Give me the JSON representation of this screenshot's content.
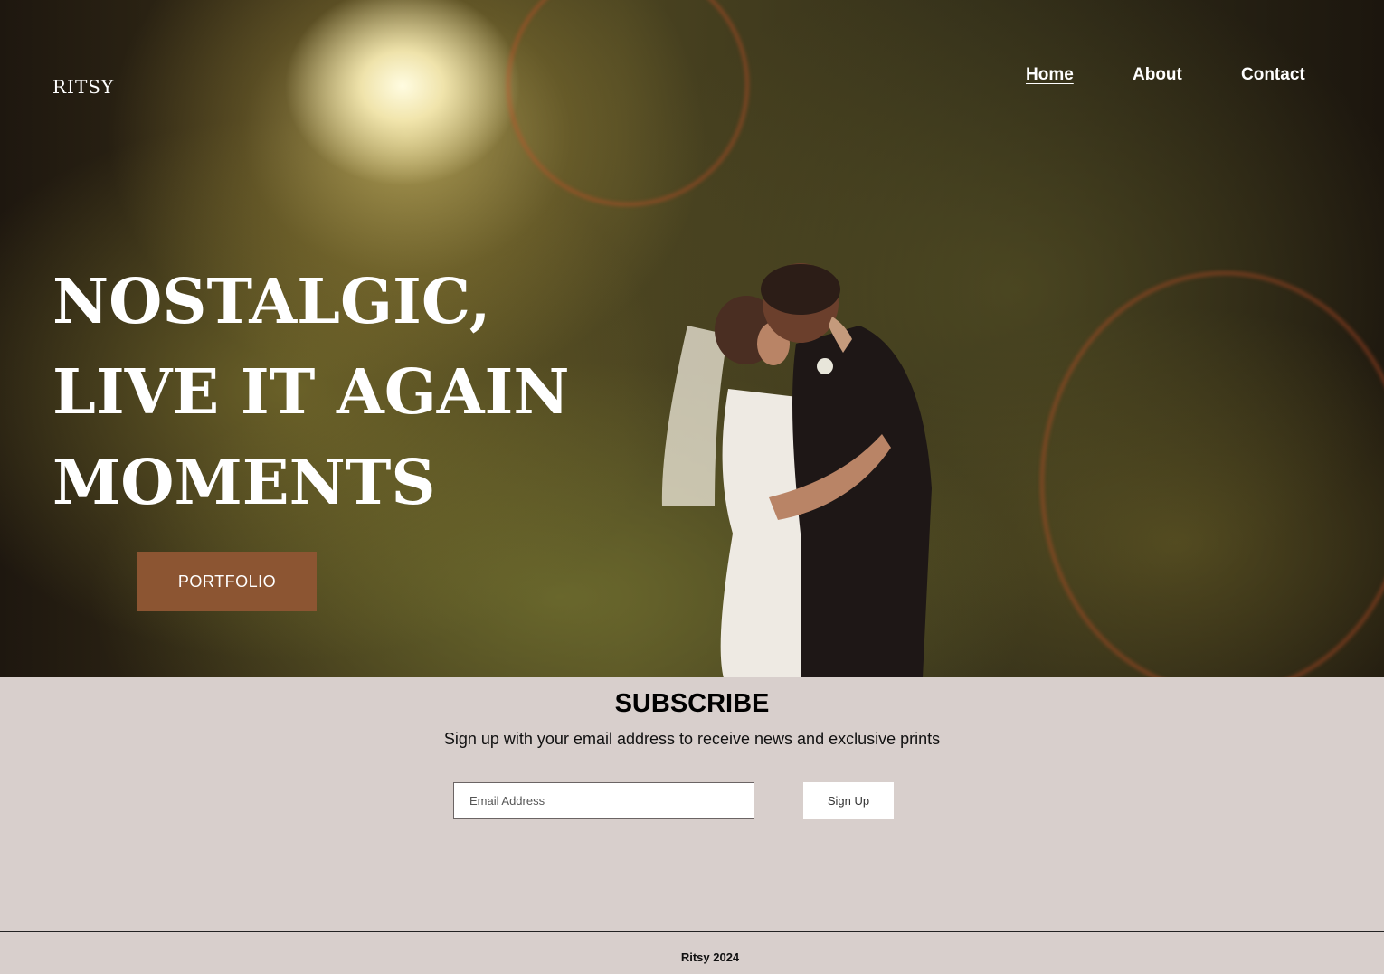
{
  "brand": {
    "name": "RITSY"
  },
  "nav": {
    "items": [
      "Home",
      "About",
      "Contact"
    ],
    "active": "Home"
  },
  "hero": {
    "headline": [
      "NOSTALGIC,",
      "LIVE IT AGAIN",
      "MOMENTS"
    ],
    "button_label": "PORTFOLIO"
  },
  "subscribe": {
    "title": "SUBSCRIBE",
    "text": "Sign up with your email address to receive news and exclusive prints",
    "email_placeholder": "Email Address",
    "button_label": "Sign Up"
  },
  "footer": {
    "text": "Ritsy 2024"
  },
  "colors": {
    "accent": "#8c5532",
    "background": "#d8cfcc",
    "text_on_image": "#ffffff"
  }
}
